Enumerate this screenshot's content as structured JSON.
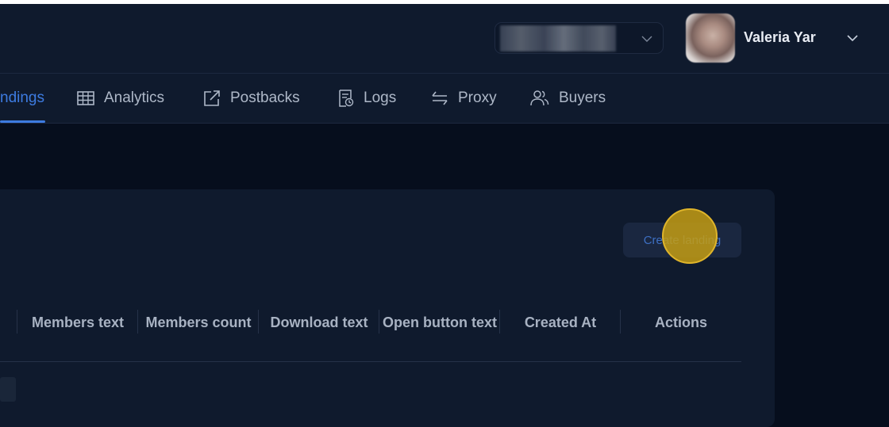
{
  "header": {
    "user_name": "Valeria Yar",
    "user_menu_icon": "chevron-down-icon",
    "workspace_icon": "chevron-down-icon"
  },
  "nav": {
    "active_index": 0,
    "items": [
      {
        "label": "ndings",
        "icon": "document-icon"
      },
      {
        "label": "Analytics",
        "icon": "table-grid-icon"
      },
      {
        "label": "Postbacks",
        "icon": "external-link-icon"
      },
      {
        "label": "Logs",
        "icon": "log-file-icon"
      },
      {
        "label": "Proxy",
        "icon": "swap-arrows-icon"
      },
      {
        "label": "Buyers",
        "icon": "users-icon"
      }
    ]
  },
  "main": {
    "create_button_label": "Create landing",
    "table": {
      "columns": [
        "Members text",
        "Members count",
        "Download text",
        "Open button text",
        "Created At",
        "Actions"
      ]
    }
  },
  "colors": {
    "accent": "#3d7be0",
    "background": "#060e1d",
    "panel": "#0f1a2d",
    "click_marker": "#c49e14"
  }
}
